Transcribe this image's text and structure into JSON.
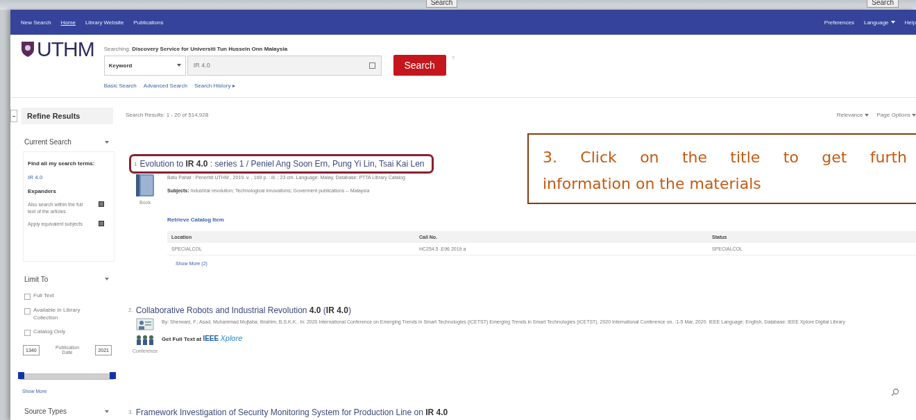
{
  "top_strip": {
    "buttons": [
      "Search",
      "Search"
    ]
  },
  "nav": {
    "left": [
      {
        "label": "New Search",
        "selected": false
      },
      {
        "label": "Home",
        "selected": true
      },
      {
        "label": "Library Website",
        "selected": false
      },
      {
        "label": "Publications",
        "selected": false
      }
    ],
    "right": [
      "Preferences",
      "Language",
      "Help"
    ]
  },
  "header": {
    "logo": "UTHM",
    "searching_label": "Searching:",
    "searching_value": "Discovery Service for Universiti Tun Hussein Onn Malaysia",
    "field_select": "Keyword",
    "query": "IR 4.0",
    "search_button": "Search",
    "help": "?",
    "links": [
      "Basic Search",
      "Advanced Search",
      "Search History ▸"
    ]
  },
  "sidebar": {
    "title": "Refine Results",
    "current_search": {
      "heading": "Current Search",
      "find_label": "Find all my search terms:",
      "term": "IR 4.0",
      "expanders_heading": "Expanders",
      "expanders": [
        "Also search within the full text of the articles",
        "Apply equivalent subjects"
      ]
    },
    "limit_to": {
      "heading": "Limit To",
      "options": [
        {
          "label": "Full Text",
          "checked": false
        },
        {
          "label": "Available in Library Collection",
          "checked": false
        },
        {
          "label": "Catalog Only",
          "checked": false
        }
      ],
      "date_from": "1340",
      "date_label": "Publication Date",
      "date_to": "2021",
      "range": {
        "level": 1
      },
      "show_more": "Show More"
    },
    "source_types": {
      "heading": "Source Types"
    }
  },
  "results_bar": {
    "count": "Search Results: 1 - 20 of 514,928",
    "sort": "Relevance",
    "options": "Page Options"
  },
  "results": [
    {
      "number": "1",
      "title": "Evolution to **IR 4.0** : series 1 / Peniel Ang Soon Ern, Pung Yi Lin, Tsai Kai Len",
      "highlighted": true,
      "kind": "book",
      "type_label": "Book",
      "meta": [
        "Batu Pahat : Penerbit UTHM , 2019. v. , 169 p. : ill. ; 23 cm. Language: Malay, Database: PTTA Library Catalog",
        "**Subjects:** Industrial revolution; Technological innovations; Goverment publications -- Malaysia"
      ],
      "link": "Retrieve Catalog Item",
      "holdings": {
        "columns": [
          "Location",
          "Call No.",
          "Status"
        ],
        "rows": [
          [
            "SPECIALCOL",
            "HC254.5 .E96 2019 a",
            "SPECIALCOL"
          ]
        ]
      },
      "show_more": "Show More (2)"
    },
    {
      "number": "2.",
      "title": "Collaborative Robots and Industrial Revolution **4.0** (**IR 4.0**)",
      "highlighted": false,
      "kind": "conference",
      "type_label": "Conference",
      "meta": [
        "By: Sherwani, F.; Asad, Muhammad Mujtaba; Ibrahim, B.S.K.K.. In: 2020 International Conference on Emerging Trends in Smart Technologies (ICETST) Emerging Trends in Smart Technologies (ICETST), 2020 International Conference on. :1-5 Mar, 2020. IEEE Language: English, Database: IEEE Xplore Digital Library"
      ],
      "fulltext": {
        "label": "Get Full Text at",
        "brand": "IEEE",
        "product": "Xplore"
      }
    },
    {
      "number": "3.",
      "title": "Framework Investigation of Security Monitoring System for Production Line on **IR 4.0**",
      "highlighted": false,
      "preview_icon": true
    }
  ],
  "callout": {
    "lines": [
      "3. Click on the title to get furth",
      "information on the materials"
    ]
  }
}
